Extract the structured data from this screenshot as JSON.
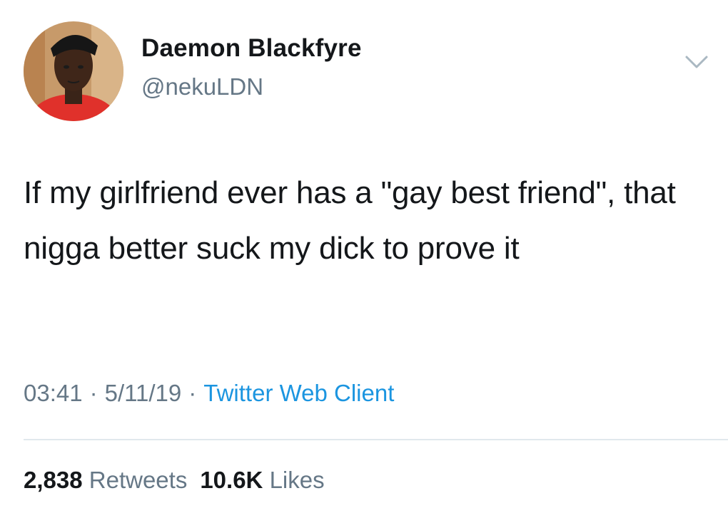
{
  "author": {
    "display_name": "Daemon Blackfyre",
    "handle": "@nekuLDN"
  },
  "tweet": {
    "text": "If my girlfriend ever has a \"gay best friend\", that nigga better suck my dick to prove it"
  },
  "meta": {
    "time": "03:41",
    "separator": "·",
    "date": "5/11/19",
    "client": "Twitter Web Client"
  },
  "stats": {
    "retweets_count": "2,838",
    "retweets_label": "Retweets",
    "likes_count": "10.6K",
    "likes_label": "Likes"
  },
  "icons": {
    "menu": "chevron-down-icon"
  },
  "colors": {
    "text": "#14171a",
    "secondary": "#657786",
    "link": "#1b95e0",
    "divider": "#e1e8ed"
  }
}
